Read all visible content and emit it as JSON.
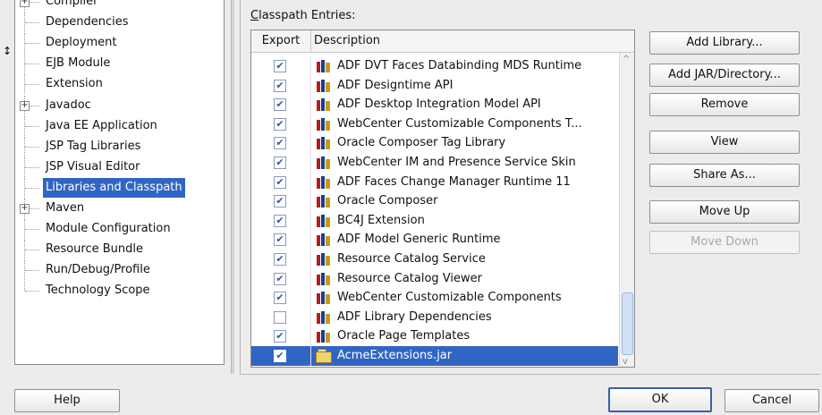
{
  "nav": {
    "items": [
      {
        "label": "Compiler",
        "expandable": true
      },
      {
        "label": "Dependencies",
        "expandable": false
      },
      {
        "label": "Deployment",
        "expandable": false
      },
      {
        "label": "EJB Module",
        "expandable": false
      },
      {
        "label": "Extension",
        "expandable": false
      },
      {
        "label": "Javadoc",
        "expandable": true
      },
      {
        "label": "Java EE Application",
        "expandable": false
      },
      {
        "label": "JSP Tag Libraries",
        "expandable": false
      },
      {
        "label": "JSP Visual Editor",
        "expandable": false
      },
      {
        "label": "Libraries and Classpath",
        "expandable": false,
        "selected": true
      },
      {
        "label": "Maven",
        "expandable": true
      },
      {
        "label": "Module Configuration",
        "expandable": false
      },
      {
        "label": "Resource Bundle",
        "expandable": false
      },
      {
        "label": "Run/Debug/Profile",
        "expandable": false
      },
      {
        "label": "Technology Scope",
        "expandable": false
      }
    ]
  },
  "classpath": {
    "label_mnemonic": "C",
    "label_rest": "lasspath Entries:",
    "columns": {
      "export": "Export",
      "description": "Description"
    },
    "rows": [
      {
        "export": true,
        "description": "ADF DVT Faces Databinding MDS Runtime",
        "icon": "library-icon"
      },
      {
        "export": true,
        "description": "ADF Designtime API",
        "icon": "library-icon"
      },
      {
        "export": true,
        "description": "ADF Desktop Integration Model API",
        "icon": "library-icon"
      },
      {
        "export": true,
        "description": "WebCenter Customizable Components T...",
        "icon": "library-icon"
      },
      {
        "export": true,
        "description": "Oracle Composer Tag Library",
        "icon": "library-icon"
      },
      {
        "export": true,
        "description": "WebCenter IM and Presence Service Skin",
        "icon": "library-icon"
      },
      {
        "export": true,
        "description": "ADF Faces Change Manager Runtime 11",
        "icon": "library-icon"
      },
      {
        "export": true,
        "description": "Oracle Composer",
        "icon": "library-icon"
      },
      {
        "export": true,
        "description": "BC4J Extension",
        "icon": "library-icon"
      },
      {
        "export": true,
        "description": "ADF Model Generic Runtime",
        "icon": "library-icon"
      },
      {
        "export": true,
        "description": "Resource Catalog Service",
        "icon": "library-icon"
      },
      {
        "export": true,
        "description": "Resource Catalog Viewer",
        "icon": "library-icon"
      },
      {
        "export": true,
        "description": "WebCenter Customizable Components",
        "icon": "library-icon"
      },
      {
        "export": false,
        "description": "ADF Library Dependencies",
        "icon": "library-icon"
      },
      {
        "export": true,
        "description": "Oracle Page Templates",
        "icon": "library-icon"
      },
      {
        "export": true,
        "description": "AcmeExtensions.jar",
        "icon": "jar-icon",
        "selected": true
      }
    ]
  },
  "actions": {
    "add_library": "Add Library...",
    "add_jar": "Add JAR/Directory...",
    "remove": "Remove",
    "view": "View",
    "share_as": "Share As...",
    "move_up": "Move Up",
    "move_down": "Move Down"
  },
  "footer": {
    "help": "Help",
    "ok": "OK",
    "cancel": "Cancel"
  },
  "colors": {
    "selection": "#3165c4",
    "checkmark": "#2c5aa0"
  }
}
